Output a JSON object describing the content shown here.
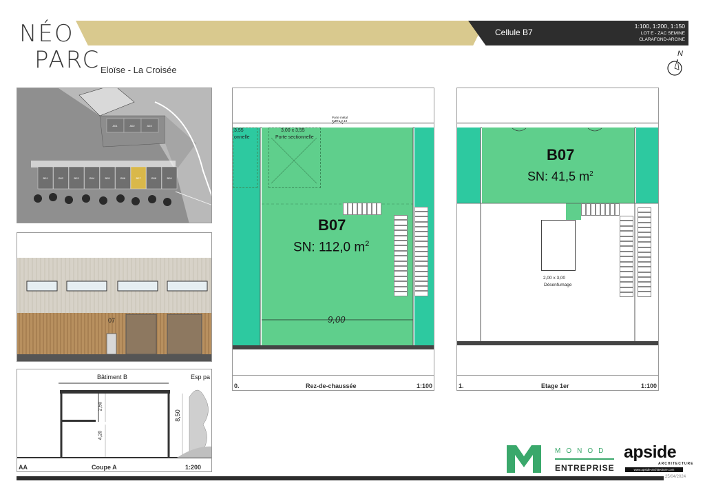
{
  "brand": {
    "logo_line1": "NÉO",
    "logo_line2": "PARC",
    "project": "Eloïse - La Croisée"
  },
  "header": {
    "cell_title": "Cellule B7",
    "scales": "1:100, 1:200, 1:150",
    "lot": "LOT E - ZAC SEMINE",
    "location": "CLARAFOND-ARCINE",
    "north": "N"
  },
  "ground_floor": {
    "room_code": "B07",
    "sn_prefix": "SN:",
    "sn_value": "112,0 m",
    "sn_exp": "2",
    "door_a_size": "3,00 x 3,55",
    "door_a_label": "Porte sectionnelle",
    "door_b_size": "3,55",
    "door_b_label": "onnelle",
    "small_door_label": "Porte métal",
    "small_door_size": "0,90 x 2,10",
    "width_dim": "9,00",
    "caption_num": "0.",
    "caption_title": "Rez-de-chaussée",
    "caption_scale": "1:100"
  },
  "first_floor": {
    "room_code": "B07",
    "sn_prefix": "SN:",
    "sn_value": "41,5 m",
    "sn_exp": "2",
    "smoke_size": "2,00 x 3,00",
    "smoke_label": "Désenfumage",
    "caption_num": "1.",
    "caption_title": "Etage 1er",
    "caption_scale": "1:100"
  },
  "section": {
    "building_label": "Bâtiment B",
    "side_label": "Esp pa",
    "dim_upper": "2,50",
    "dim_lower": "4,20",
    "dim_total": "8,50",
    "caption_num": "AA",
    "caption_title": "Coupe A",
    "caption_scale": "1:200"
  },
  "facade": {
    "unit_label": "07"
  },
  "site_plan": {
    "units": [
      "B01",
      "B02",
      "B03",
      "B04",
      "B05",
      "B06",
      "B07",
      "B08",
      "B09"
    ],
    "upper_units": [
      "A01",
      "A02",
      "A03"
    ]
  },
  "partners": {
    "monod_top": "MONOD",
    "monod_bottom": "ENTREPRISE",
    "apside": "apside",
    "apside_sub": "ARCHITECTURE",
    "apside_url": "www.apside-architecture.com",
    "date": "25/04/2024"
  },
  "colors": {
    "accent_gold": "#d9c98e",
    "dark": "#2d2d2d",
    "green_area": "#5fcf8c",
    "teal_area": "#2dc9a0",
    "monod_green": "#3aa86b"
  }
}
